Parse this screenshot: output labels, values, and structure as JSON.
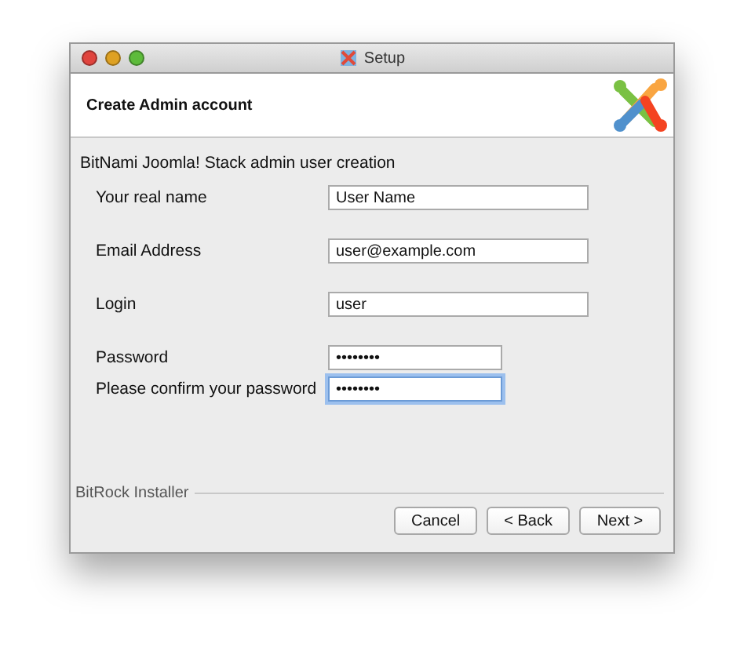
{
  "window": {
    "title": "Setup"
  },
  "header": {
    "title": "Create Admin account"
  },
  "subtitle": "BitNami Joomla! Stack admin user creation",
  "fields": [
    {
      "label": "Your real name",
      "value": "User Name",
      "kind": "text",
      "focused": false
    },
    {
      "label": "Email Address",
      "value": "user@example.com",
      "kind": "text",
      "focused": false
    },
    {
      "label": "Login",
      "value": "user",
      "kind": "text",
      "focused": false
    },
    {
      "label": "Password",
      "value": "••••••••",
      "kind": "password",
      "focused": false
    },
    {
      "label": "Please confirm your password",
      "value": "••••••••",
      "kind": "password",
      "focused": true
    }
  ],
  "footer": {
    "label": "BitRock Installer"
  },
  "buttons": [
    "Cancel",
    "< Back",
    "Next >"
  ]
}
